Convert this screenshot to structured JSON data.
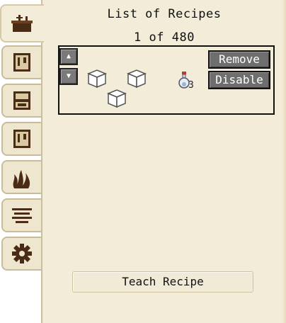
{
  "header": {
    "title": "List of Recipes",
    "page_counter": "1 of 480"
  },
  "tabs": [
    {
      "icon": "cake-icon",
      "active": true
    },
    {
      "icon": "book-icon",
      "active": false
    },
    {
      "icon": "furnace-icon",
      "active": false
    },
    {
      "icon": "book-icon",
      "active": false
    },
    {
      "icon": "fire-icon",
      "active": false
    },
    {
      "icon": "wind-icon",
      "active": false
    },
    {
      "icon": "gear-icon",
      "active": false
    }
  ],
  "recipe": {
    "up_label": "▲",
    "down_label": "▼",
    "ingredients": [
      "cube-icon",
      "cube-icon",
      "cube-icon"
    ],
    "output": {
      "icon": "potion-icon",
      "count": "3"
    },
    "remove_label": "Remove",
    "disable_label": "Disable"
  },
  "footer": {
    "teach_label": "Teach Recipe"
  },
  "colors": {
    "parchment": "#f3ecd8",
    "button_gray": "#6e6e6e",
    "icon_brown": "#4a2c16"
  }
}
